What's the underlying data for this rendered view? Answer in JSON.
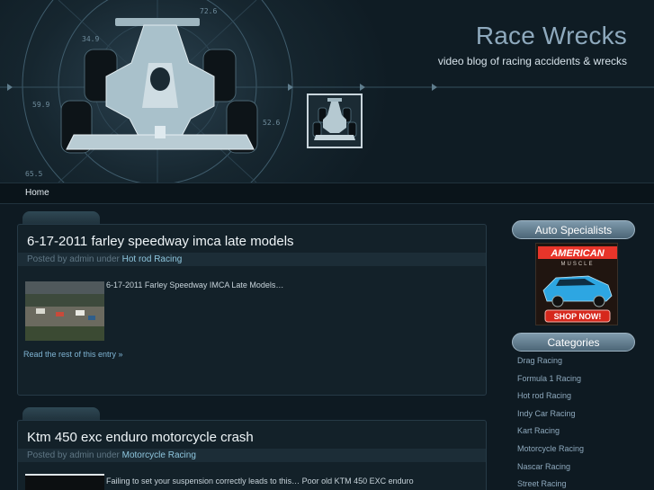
{
  "site": {
    "title": "Race Wrecks",
    "tagline": "video blog of racing accidents & wrecks"
  },
  "hud": {
    "readouts": [
      "72.6",
      "34.9",
      "59.9",
      "52.6",
      "65.5"
    ]
  },
  "nav": {
    "items": [
      {
        "label": "Home"
      }
    ]
  },
  "posts": [
    {
      "title": "6-17-2011 farley speedway imca late models",
      "meta_prefix": "Posted by admin under",
      "category": "Hot rod Racing",
      "excerpt": "6-17-2011 Farley Speedway IMCA Late Models…",
      "read_more": "Read the rest of this entry »"
    },
    {
      "title": "Ktm 450 exc enduro motorcycle crash",
      "meta_prefix": "Posted by admin under",
      "category": "Motorcycle Racing",
      "excerpt": "Failing to set your suspension correctly leads to this… Poor old KTM 450 EXC enduro"
    }
  ],
  "sidebar": {
    "auto_title": "Auto Specialists",
    "ad": {
      "brand_top": "AMERICAN",
      "brand_bottom": "MUSCLE",
      "cta": "SHOP NOW!"
    },
    "categories_title": "Categories",
    "categories": [
      "Drag Racing",
      "Formula 1 Racing",
      "Hot rod Racing",
      "Indy Car Racing",
      "Kart Racing",
      "Motorcycle Racing",
      "Nascar Racing",
      "Street Racing"
    ]
  },
  "colors": {
    "background": "#0e1a22",
    "title": "#8ea9bd",
    "link": "#8ec6de",
    "widget_pill": "#6a8596"
  }
}
